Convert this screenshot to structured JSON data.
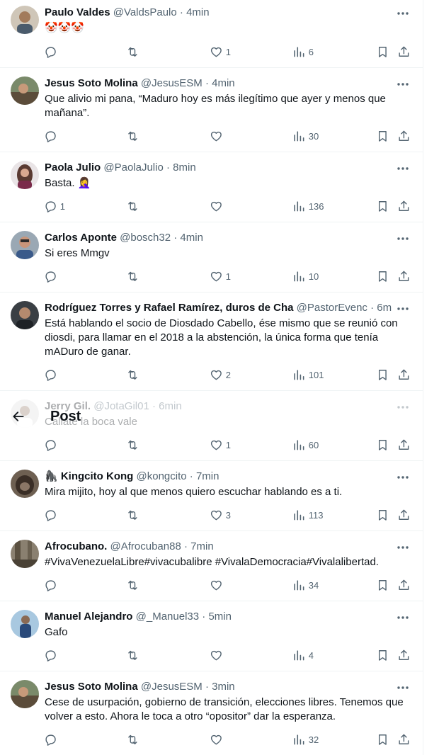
{
  "header": {
    "title": "Post"
  },
  "tweets": [
    {
      "name": "Paulo Valdes",
      "handle": "@ValdsPaulo",
      "time": "4min",
      "text": "🤡🤡🤡",
      "replies": "",
      "retweets": "",
      "likes": "1",
      "views": "6"
    },
    {
      "name": "Jesus Soto Molina",
      "handle": "@JesusESM",
      "time": "4min",
      "text": "Que alivio mi pana, “Maduro hoy es más ilegítimo que ayer y menos que mañana”.",
      "replies": "",
      "retweets": "",
      "likes": "",
      "views": "30"
    },
    {
      "name": "Paola Julio",
      "handle": "@PaolaJulio",
      "time": "8min",
      "text": "Basta. 🤦‍♀️",
      "replies": "1",
      "retweets": "",
      "likes": "",
      "views": "136"
    },
    {
      "name": "Carlos Aponte",
      "handle": "@bosch32",
      "time": "4min",
      "text": "Si eres Mmgv",
      "replies": "",
      "retweets": "",
      "likes": "1",
      "views": "10"
    },
    {
      "name": "Rodríguez Torres y Rafael Ramírez, duros de Cha",
      "handle": "@PastorEvenc",
      "time": "6min",
      "text": "Está hablando el socio de Diosdado Cabello, ése mismo que se reunió con diosdi, para llamar en el 2018 a la abstención, la única forma que tenía mADuro de ganar.",
      "replies": "",
      "retweets": "",
      "likes": "2",
      "views": "101"
    },
    {
      "name": "Jerry Gil.",
      "handle": "@JotaGil01",
      "time": "6min",
      "text": "Callate la boca vale",
      "replies": "",
      "retweets": "",
      "likes": "1",
      "views": "60"
    },
    {
      "name": "🦍 Kingcito Kong",
      "handle": "@kongcito",
      "time": "7min",
      "text": "Mira mijito, hoy al que menos quiero escuchar hablando es a ti.",
      "replies": "",
      "retweets": "",
      "likes": "3",
      "views": "113"
    },
    {
      "name": "Afrocubano.",
      "handle": "@Afrocuban88",
      "time": "7min",
      "text": "#VivaVenezuelaLibre#vivacubalibre #VivalaDemocracia#Vivalalibertad.",
      "replies": "",
      "retweets": "",
      "likes": "",
      "views": "34"
    },
    {
      "name": "Manuel Alejandro",
      "handle": "@_Manuel33",
      "time": "5min",
      "text": "Gafo",
      "replies": "",
      "retweets": "",
      "likes": "",
      "views": "4"
    },
    {
      "name": "Jesus Soto Molina",
      "handle": "@JesusESM",
      "time": "3min",
      "text": "Cese de usurpación, gobierno de transición, elecciones libres. Tenemos que volver a esto. Ahora le toca a otro “opositor” dar la esperanza.",
      "replies": "",
      "retweets": "",
      "likes": "",
      "views": "32"
    }
  ],
  "colors": {
    "text": "#0f1419",
    "secondary": "#536471",
    "border": "#eff3f4"
  },
  "icons": {
    "reply": "reply-icon",
    "retweet": "retweet-icon",
    "like": "heart-icon",
    "views": "views-icon",
    "bookmark": "bookmark-icon",
    "share": "share-icon",
    "more": "more-icon",
    "back": "back-arrow-icon"
  }
}
